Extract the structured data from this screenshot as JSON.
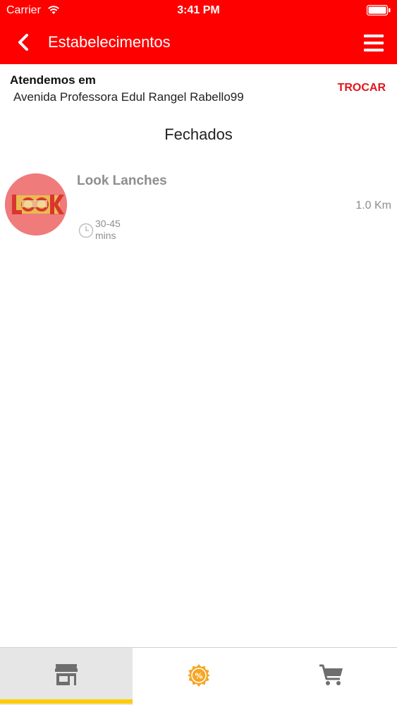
{
  "status_bar": {
    "carrier": "Carrier",
    "time": "3:41 PM"
  },
  "nav": {
    "title": "Estabelecimentos",
    "back_icon": "chevron-left-icon",
    "menu_icon": "hamburger-menu-icon"
  },
  "address": {
    "heading": "Atendemos em",
    "value": "Avenida Professora Edul Rangel Rabello99",
    "change_label": "TROCAR"
  },
  "section": {
    "title": "Fechados"
  },
  "stores": [
    {
      "name": "Look Lanches",
      "distance": "1.0 Km",
      "delivery_range": "30-45",
      "delivery_unit": "mins",
      "logo_icon": "look-lanches-logo"
    }
  ],
  "tabs": [
    {
      "icon": "store-icon",
      "selected": true
    },
    {
      "icon": "promo-badge-icon",
      "selected": false
    },
    {
      "icon": "cart-icon",
      "selected": false
    }
  ],
  "colors": {
    "header": "#ff0000",
    "accent_text": "#e3151b",
    "tab_indicator": "#ffcc00",
    "promo_badge": "#f5a623"
  }
}
